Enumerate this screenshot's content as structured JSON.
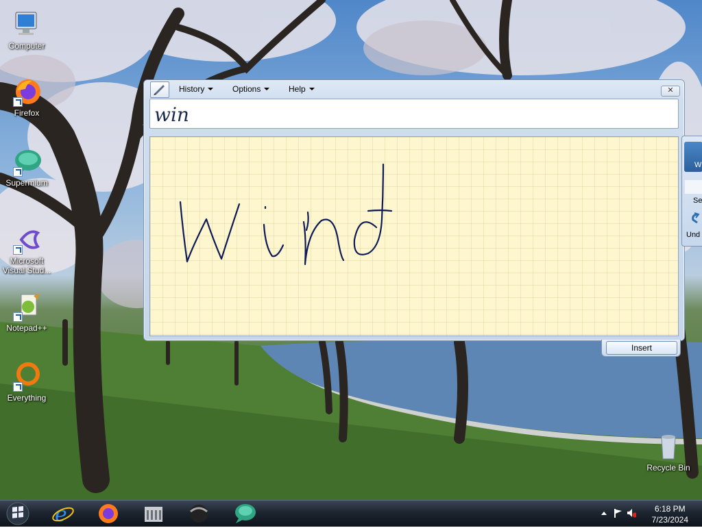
{
  "desktop": {
    "icons": [
      {
        "label": "Computer",
        "icon": "computer-icon"
      },
      {
        "label": "Firefox",
        "icon": "firefox-icon"
      },
      {
        "label": "Supermium",
        "icon": "supermium-icon"
      },
      {
        "label": "Microsoft Visual Stud...",
        "icon": "visual-studio-icon"
      },
      {
        "label": "Notepad++",
        "icon": "notepadpp-icon"
      },
      {
        "label": "Everything",
        "icon": "everything-icon"
      },
      {
        "label": "Recycle Bin",
        "icon": "recycle-bin-icon"
      }
    ]
  },
  "input_panel": {
    "menus": [
      "History",
      "Options",
      "Help"
    ],
    "close_label": "✕",
    "recognized_text": "win",
    "ink_text": "wind",
    "insert_label": "Insert",
    "side": {
      "w_label": "W",
      "se_label": "Se",
      "undo_label": "Und"
    }
  },
  "taskbar": {
    "apps": [
      "start",
      "internet-explorer",
      "firefox",
      "library",
      "media",
      "supermium"
    ],
    "clock": {
      "time": "6:18 PM",
      "date": "7/23/2024"
    }
  },
  "colors": {
    "writing_pad": "#fdf6cf",
    "ink": "#0e1a55",
    "window": "#cfdeef",
    "taskbar": "#1d2530"
  }
}
